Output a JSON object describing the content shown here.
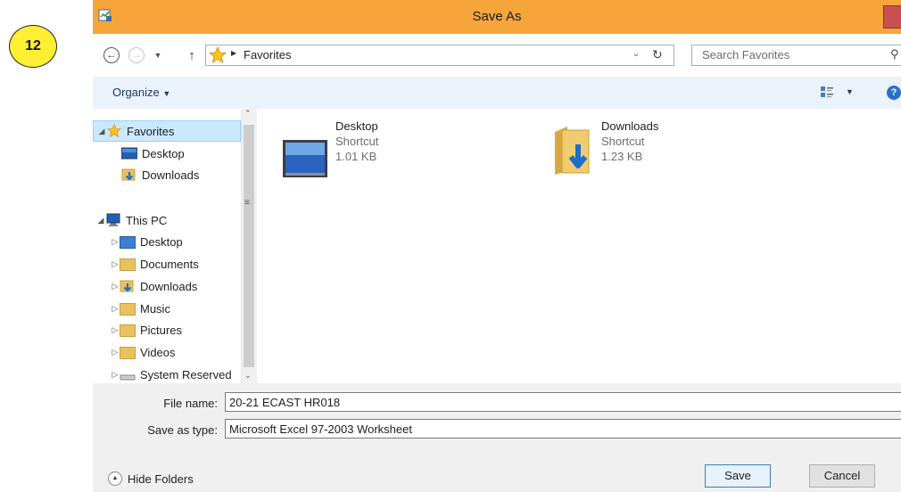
{
  "step_badge": "12",
  "window": {
    "title": "Save As"
  },
  "address_bar": {
    "crumb": "Favorites",
    "search_placeholder": "Search Favorites"
  },
  "toolbar": {
    "organize_label": "Organize"
  },
  "nav": {
    "favorites": {
      "label": "Favorites",
      "items": [
        {
          "label": "Desktop"
        },
        {
          "label": "Downloads"
        }
      ]
    },
    "this_pc": {
      "label": "This PC",
      "items": [
        {
          "label": "Desktop"
        },
        {
          "label": "Documents"
        },
        {
          "label": "Downloads"
        },
        {
          "label": "Music"
        },
        {
          "label": "Pictures"
        },
        {
          "label": "Videos"
        },
        {
          "label": "System Reserved"
        }
      ]
    }
  },
  "files": [
    {
      "name": "Desktop",
      "type": "Shortcut",
      "size": "1.01 KB",
      "icon": "monitor-icon"
    },
    {
      "name": "Downloads",
      "type": "Shortcut",
      "size": "1.23 KB",
      "icon": "downloads-folder-icon"
    }
  ],
  "form": {
    "file_name_label": "File name:",
    "file_name_value": "20-21 ECAST HR018",
    "save_type_label": "Save as type:",
    "save_type_value": "Microsoft Excel 97-2003 Worksheet"
  },
  "buttons": {
    "hide_folders": "Hide Folders",
    "save": "Save",
    "cancel": "Cancel"
  },
  "colors": {
    "titlebar": "#f5a53a",
    "toolbar": "#eaf2fb",
    "selection": "#cce8ff",
    "badge": "#ffef33"
  }
}
